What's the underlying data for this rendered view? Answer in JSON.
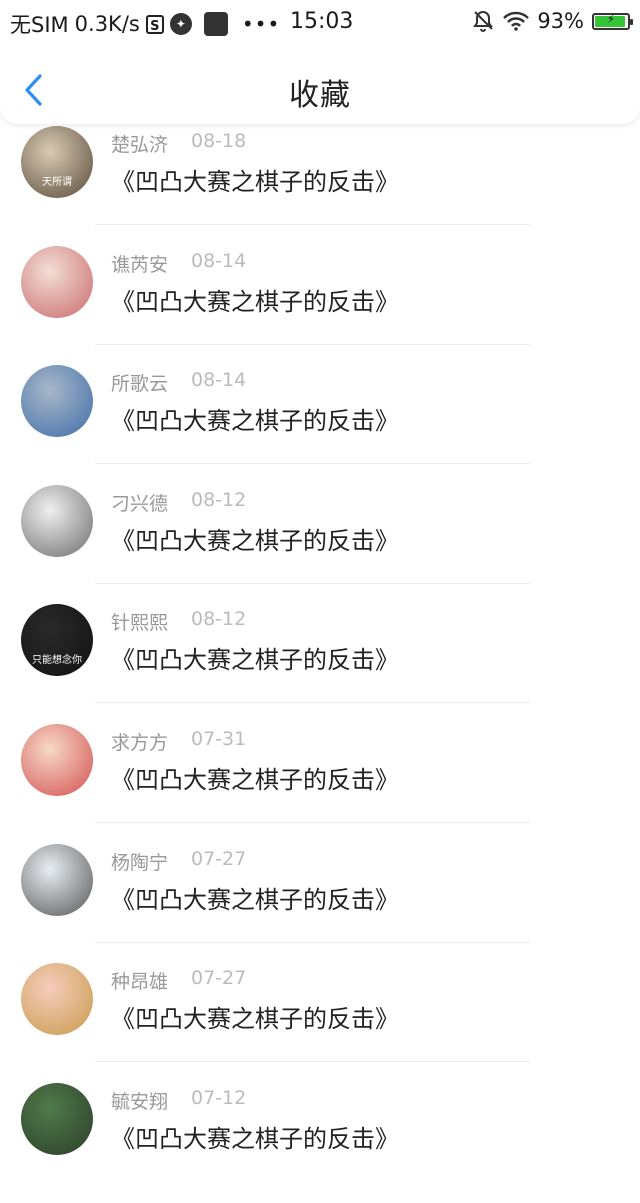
{
  "status_bar": {
    "carrier": "无SIM",
    "speed": "0.3K/s",
    "time": "15:03",
    "battery": "93%",
    "battery_level": 0.93,
    "battery_color": "#35c435"
  },
  "navbar": {
    "title": "收藏",
    "back_icon": "chevron-left-icon",
    "accent": "#2b8ef0"
  },
  "items": [
    {
      "name": "楚弘济",
      "date": "08-18",
      "title": "《凹凸大赛之棋子的反击》",
      "avatar_text": "天所谓",
      "avatar_colors": [
        "#d8cbb3",
        "#5a4a3a"
      ]
    },
    {
      "name": "谯芮安",
      "date": "08-14",
      "title": "《凹凸大赛之棋子的反击》",
      "avatar_text": "",
      "avatar_colors": [
        "#f3ded7",
        "#c96a6a"
      ]
    },
    {
      "name": "所歌云",
      "date": "08-14",
      "title": "《凹凸大赛之棋子的反击》",
      "avatar_text": "",
      "avatar_colors": [
        "#a8b7c9",
        "#3f6ea8"
      ]
    },
    {
      "name": "刁兴德",
      "date": "08-12",
      "title": "《凹凸大赛之棋子的反击》",
      "avatar_text": "",
      "avatar_colors": [
        "#f0f0f0",
        "#6c6c6c"
      ]
    },
    {
      "name": "针熙熙",
      "date": "08-12",
      "title": "《凹凸大赛之棋子的反击》",
      "avatar_text": "只能想念你",
      "avatar_colors": [
        "#2a2a2a",
        "#111111"
      ]
    },
    {
      "name": "求方方",
      "date": "07-31",
      "title": "《凹凸大赛之棋子的反击》",
      "avatar_text": "",
      "avatar_colors": [
        "#f7d9c7",
        "#d25050"
      ]
    },
    {
      "name": "杨陶宁",
      "date": "07-27",
      "title": "《凹凸大赛之棋子的反击》",
      "avatar_text": "",
      "avatar_colors": [
        "#e9eef2",
        "#555555"
      ]
    },
    {
      "name": "种昂雄",
      "date": "07-27",
      "title": "《凹凸大赛之棋子的反击》",
      "avatar_text": "",
      "avatar_colors": [
        "#f5cdbd",
        "#c99a4a"
      ]
    },
    {
      "name": "毓安翔",
      "date": "07-12",
      "title": "《凹凸大赛之棋子的反击》",
      "avatar_text": "",
      "avatar_colors": [
        "#4f7b4a",
        "#2c3d2a"
      ]
    }
  ]
}
